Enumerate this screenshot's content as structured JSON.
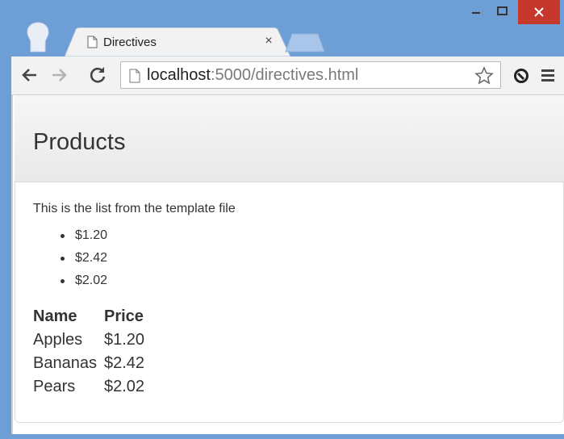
{
  "browser": {
    "tab_title": "Directives",
    "tab_close": "×",
    "url_host": "localhost",
    "url_rest": ":5000/directives.html",
    "icons": {
      "back": "back-arrow-icon",
      "forward": "forward-arrow-icon",
      "reload": "reload-icon",
      "star": "star-icon",
      "extension": "extension-icon",
      "menu": "menu-icon"
    },
    "colors": {
      "frame": "#6e9ed6",
      "close_button": "#c7382c"
    }
  },
  "page": {
    "header_title": "Products",
    "intro_text": "This is the list from the template file",
    "price_list": [
      "$1.20",
      "$2.42",
      "$2.02"
    ],
    "table": {
      "headers": [
        "Name",
        "Price"
      ],
      "rows": [
        [
          "Apples",
          "$1.20"
        ],
        [
          "Bananas",
          "$2.42"
        ],
        [
          "Pears",
          "$2.02"
        ]
      ]
    }
  }
}
